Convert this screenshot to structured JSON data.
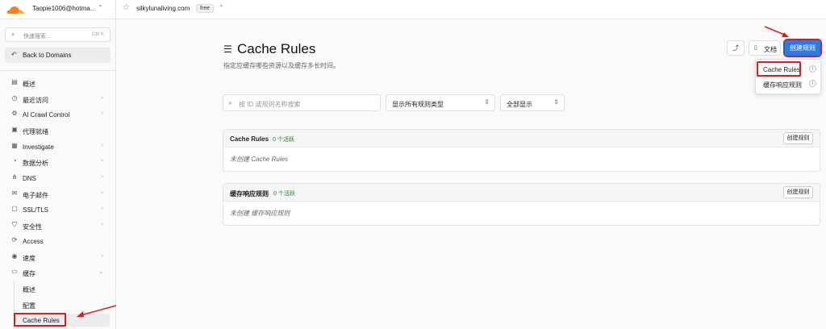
{
  "topbar": {
    "account": "Taopie1006@hotma...",
    "domain": "silkylunaliving.com",
    "plan": "free"
  },
  "sidebar": {
    "search_placeholder": "快速搜索...",
    "search_shortcut": "Ctrl K",
    "back_label": "Back to Domains",
    "items": [
      {
        "label": "概述",
        "icon": "document-icon",
        "chevron": false
      },
      {
        "label": "最近访问",
        "icon": "clock-icon",
        "chevron": true
      },
      {
        "label": "AI Crawl Control",
        "icon": "bot-icon",
        "chevron": true
      },
      {
        "label": "代理就绪",
        "icon": "agent-icon",
        "chevron": false
      },
      {
        "label": "Investigate",
        "icon": "investigate-icon",
        "chevron": true
      },
      {
        "label": "数据分析",
        "icon": "analytics-icon",
        "chevron": true
      },
      {
        "label": "DNS",
        "icon": "dns-icon",
        "chevron": true
      },
      {
        "label": "电子邮件",
        "icon": "email-icon",
        "chevron": true
      },
      {
        "label": "SSL/TLS",
        "icon": "lock-icon",
        "chevron": true
      },
      {
        "label": "安全性",
        "icon": "shield-icon",
        "chevron": true
      },
      {
        "label": "Access",
        "icon": "access-icon",
        "chevron": false
      },
      {
        "label": "速度",
        "icon": "speed-icon",
        "chevron": true
      },
      {
        "label": "缓存",
        "icon": "cache-icon",
        "chevron": true
      }
    ],
    "subitems": [
      {
        "label": "概述"
      },
      {
        "label": "配置"
      },
      {
        "label": "Cache Rules"
      }
    ]
  },
  "main": {
    "title": "Cache Rules",
    "description": "指定应缓存哪些资源以及缓存多长时间。",
    "docs_label": "文档",
    "create_label": "创建规则",
    "dropdown": [
      {
        "label": "Cache Rules"
      },
      {
        "label": "缓存响应规则"
      }
    ],
    "filter_placeholder": "按 ID 或规则名称搜索",
    "rule_type_select": "显示所有规则类型",
    "status_select": "全部显示",
    "cards": [
      {
        "title": "Cache Rules",
        "badge": "0 个活跃",
        "button": "创建规则",
        "empty": "未创建 Cache Rules"
      },
      {
        "title": "缓存响应规则",
        "badge": "0 个活跃",
        "button": "创建规则",
        "empty": "未创建 缓存响应规则"
      }
    ]
  },
  "colors": {
    "accent": "#2c7be5",
    "highlight": "#d42020",
    "badge_green": "#2a7a3b",
    "logo_orange": "#f38020"
  }
}
